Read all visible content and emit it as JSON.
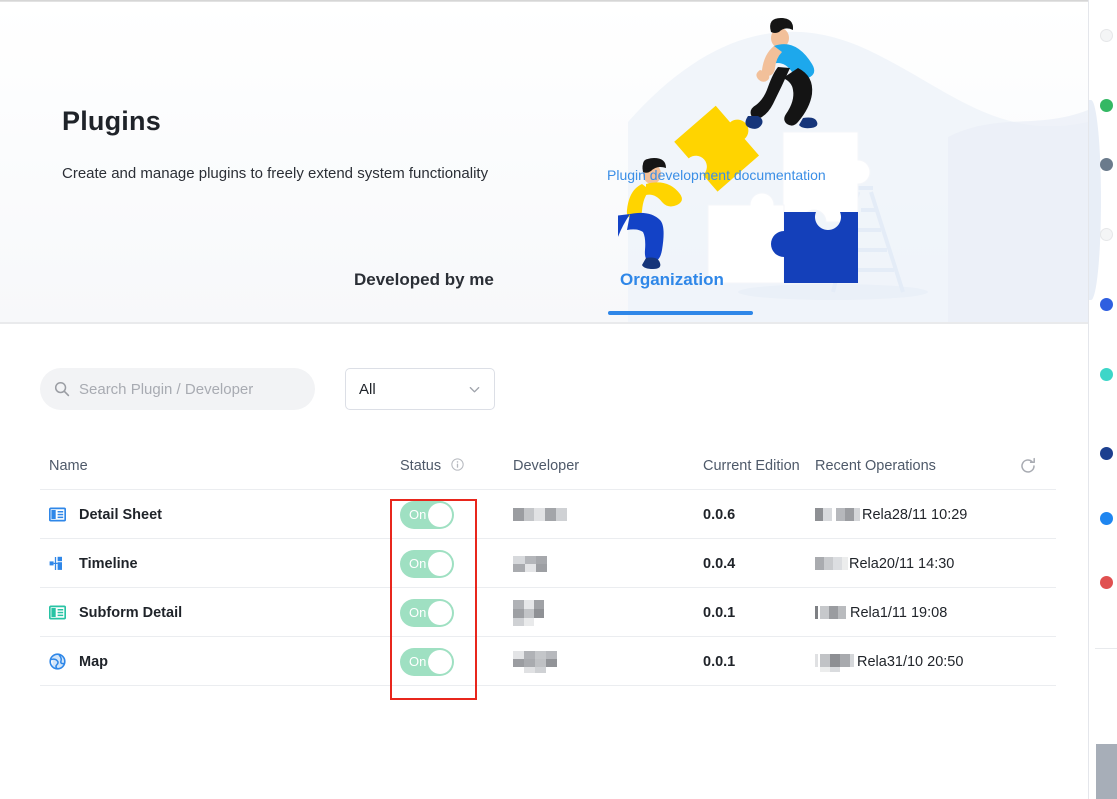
{
  "hero": {
    "title": "Plugins",
    "subtitle": "Create and manage plugins to freely extend system functionality",
    "link": "Plugin development documentation"
  },
  "tabs": [
    {
      "label": "Developed by me",
      "active": false
    },
    {
      "label": "Organization",
      "active": true
    }
  ],
  "filters": {
    "search_placeholder": "Search Plugin / Developer",
    "search_value": "",
    "select_value": "All"
  },
  "table": {
    "headers": {
      "name": "Name",
      "status": "Status",
      "developer": "Developer",
      "edition": "Current Edition",
      "operations": "Recent Operations"
    },
    "rows": [
      {
        "icon": "detail-sheet-icon",
        "name": "Detail Sheet",
        "status": "On",
        "developer": "",
        "edition": "0.0.6",
        "operation": "Rela28/11 10:29"
      },
      {
        "icon": "timeline-icon",
        "name": "Timeline",
        "status": "On",
        "developer": "",
        "edition": "0.0.4",
        "operation": "Rela20/11 14:30"
      },
      {
        "icon": "subform-detail-icon",
        "name": "Subform Detail",
        "status": "On",
        "developer": "",
        "edition": "0.0.1",
        "operation": "Rela1/11 19:08"
      },
      {
        "icon": "map-icon",
        "name": "Map",
        "status": "On",
        "developer": "",
        "edition": "0.0.1",
        "operation": "Rela31/10 20:50"
      }
    ]
  },
  "colors": {
    "accent_blue": "#2f87e8",
    "link_blue": "#3a8ee6",
    "toggle_on": "#9fe0c2",
    "annotation_red": "#e8261c",
    "text_primary": "#1f2329",
    "text_secondary": "#4e5969"
  },
  "right_rail": {
    "dots": [
      "#f2f3f5",
      "#34b864",
      "#6b7b8c",
      "#f2f3f5",
      "#2f5fe0",
      "#3dd6c8",
      "#1c3f8f",
      "#1f86f0",
      "#e05050"
    ]
  }
}
